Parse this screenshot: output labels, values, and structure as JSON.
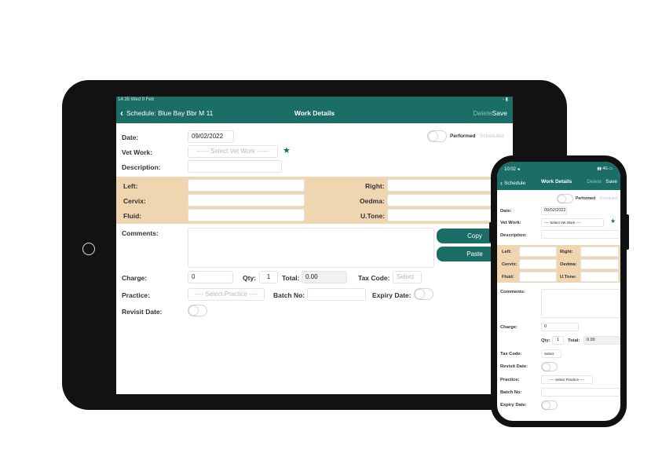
{
  "colors": {
    "accent": "#1a6e66",
    "band": "#efd5b0",
    "muted": "#8fbfba"
  },
  "tablet": {
    "status": {
      "left": "14:35  Wed 9 Feb",
      "right": "◦ ▮"
    },
    "nav": {
      "back": "Schedule: Blue Bay Bbr  M  11",
      "title": "Work Details",
      "delete": "Delete",
      "save": "Save"
    },
    "form": {
      "date_label": "Date:",
      "date_value": "09/02/2022",
      "performed": "Performed",
      "scheduled": "Scheduled",
      "vet_work_label": "Vet Work:",
      "vet_work_placeholder": "------ Select Vet Work ------",
      "description_label": "Description:",
      "left_label": "Left:",
      "right_label": "Right:",
      "cervix_label": "Cervix:",
      "oedma_label": "Oedma:",
      "fluid_label": "Fluid:",
      "utone_label": "U.Tone:",
      "comments_label": "Comments:",
      "copy": "Copy",
      "paste": "Paste",
      "charge_label": "Charge:",
      "charge_value": "0",
      "qty_label": "Qty:",
      "qty_value": "1",
      "total_label": "Total:",
      "total_value": "0.00",
      "tax_code_label": "Tax Code:",
      "tax_code_placeholder": "Select",
      "practice_label": "Practice:",
      "practice_placeholder": "---- Select Practice ----",
      "batch_label": "Batch No:",
      "expiry_label": "Expiry Date:",
      "revisit_label": "Revisit Date:"
    }
  },
  "phone": {
    "status": {
      "time": "10:02 ◂",
      "signal": "▮▮ 4G ▭"
    },
    "nav": {
      "back": "Schedule",
      "title": "Work Details",
      "delete": "Delete",
      "save": "Save"
    },
    "form": {
      "performed": "Performed",
      "scheduled": "Scheduled",
      "date_label": "Date:",
      "date_value": "09/02/2022",
      "vet_work_label": "Vet Work:",
      "vet_work_placeholder": "---- Select Vet Work ----",
      "description_label": "Description:",
      "left_label": "Left:",
      "right_label": "Right:",
      "cervix_label": "Cervix:",
      "oedma_label": "Oedma:",
      "fluid_label": "Fluid:",
      "utone_label": "U.Tone:",
      "comments_label": "Comments:",
      "charge_label": "Charge:",
      "charge_value": "0",
      "qty_label": "Qty:",
      "qty_value": "1",
      "total_label": "Total:",
      "total_value": "0.00",
      "tax_code_label": "Tax Code:",
      "tax_code_placeholder": "Select",
      "revisit_label": "Revisit Date:",
      "practice_label": "Practice:",
      "practice_placeholder": "---- Select Practice ----",
      "batch_label": "Batch No:",
      "expiry_label": "Expiry Date:"
    }
  }
}
